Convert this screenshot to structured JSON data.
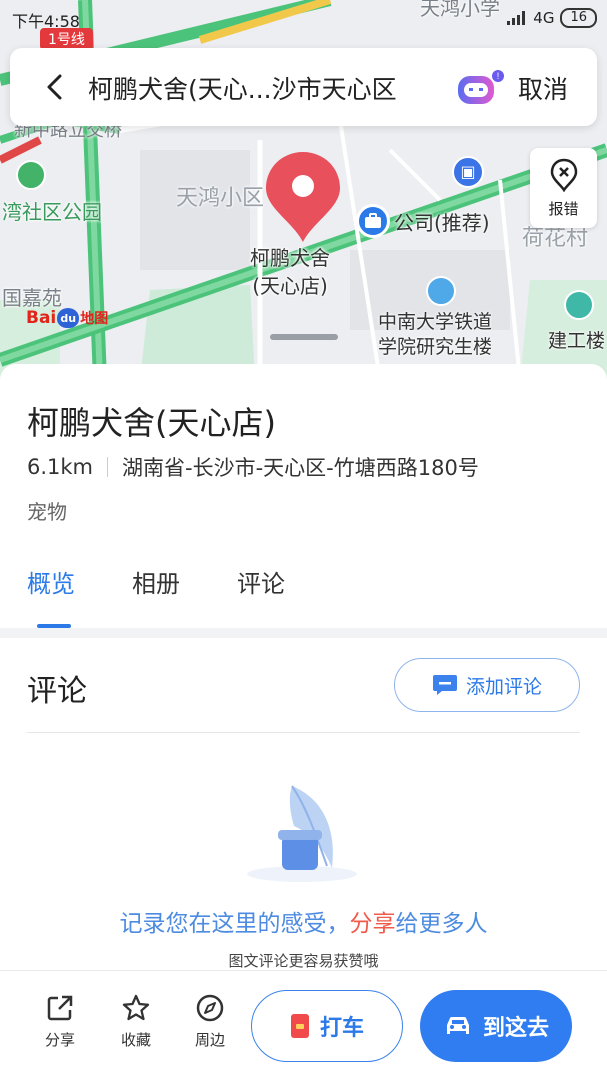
{
  "status_bar": {
    "time": "下午4:58",
    "network": "4G",
    "battery": "16"
  },
  "map": {
    "labels": {
      "metro_line": "1号线",
      "school": "天鸿小学",
      "bridge": "新中路立交桥",
      "park": "湾社区公园",
      "community": "天鸿小区",
      "company": "公司(推荐)",
      "lotus": "荷花村",
      "garden": "国嘉苑",
      "railway_college": "中南大学铁道学院研究生楼",
      "railway_college_line1": "中南大学铁道",
      "railway_college_line2": "学院研究生楼",
      "building": "建工楼"
    },
    "pin_label_line1": "柯鹏犬舍",
    "pin_label_line2": "(天心店)",
    "report_label": "报错",
    "logo_text": "Baidu",
    "logo_suffix": "地图"
  },
  "search_bar": {
    "title": "柯鹏犬舍(天心...沙市天心区",
    "cancel_label": "取消"
  },
  "place": {
    "name": "柯鹏犬舍(天心店)",
    "distance": "6.1km",
    "address": "湖南省-长沙市-天心区-竹塘西路180号",
    "category": "宠物"
  },
  "tabs": [
    {
      "label": "概览",
      "active": true
    },
    {
      "label": "相册",
      "active": false
    },
    {
      "label": "评论",
      "active": false
    }
  ],
  "reviews": {
    "title": "评论",
    "add_label": "添加评论",
    "empty_msg_before": "记录您在这里的感受，",
    "empty_msg_highlight": "分享",
    "empty_msg_after": "给更多人",
    "empty_sub": "图文评论更容易获赞哦"
  },
  "bottom_bar": {
    "share": "分享",
    "favorite": "收藏",
    "nearby": "周边",
    "taxi": "打车",
    "go_there": "到这去"
  },
  "colors": {
    "accent": "#2b7ae8",
    "pin": "#e8505b",
    "highlight": "#f05a4a"
  }
}
